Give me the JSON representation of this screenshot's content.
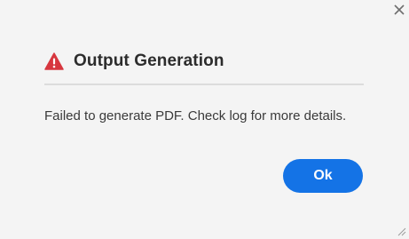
{
  "dialog": {
    "title": "Output Generation",
    "message": "Failed to generate PDF. Check log for more details.",
    "ok_label": "Ok",
    "close_icon": "close-icon",
    "warning_icon": "warning-icon"
  },
  "colors": {
    "background": "#f4f4f4",
    "accent": "#1473e6",
    "warning": "#d7373f",
    "title_text": "#2c2c2c",
    "body_text": "#3a3a3a"
  }
}
